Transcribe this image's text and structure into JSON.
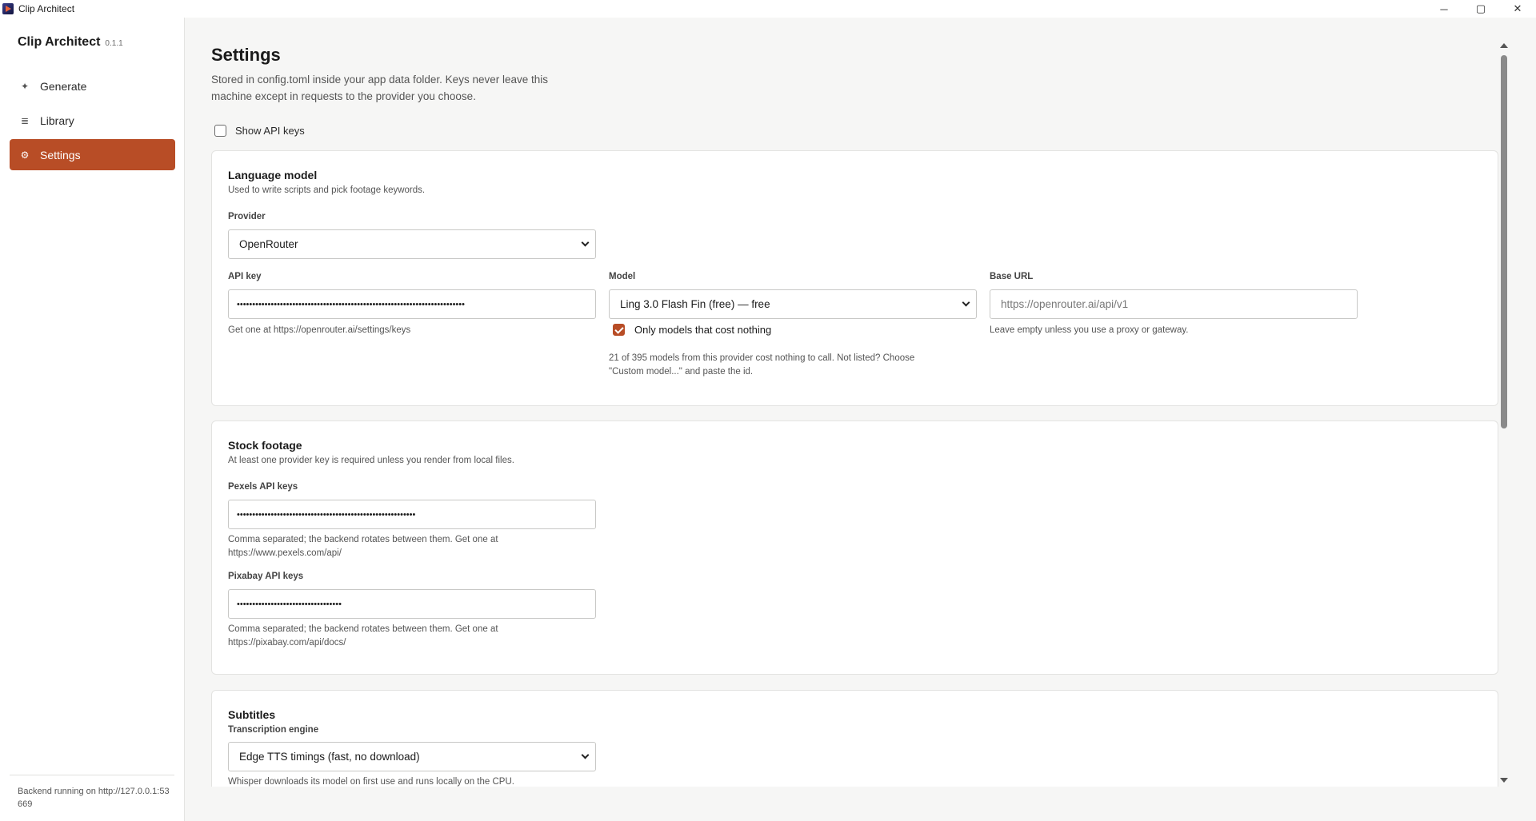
{
  "window": {
    "title": "Clip Architect",
    "controls": {
      "minimize": "─",
      "maximize": "▢",
      "close": "✕"
    }
  },
  "sidebar": {
    "app_name": "Clip Architect",
    "version": "0.1.1",
    "items": [
      {
        "label": "Generate",
        "icon": "sparkle-icon",
        "glyph": "✦",
        "active": false
      },
      {
        "label": "Library",
        "icon": "list-icon",
        "glyph": "≣",
        "active": false
      },
      {
        "label": "Settings",
        "icon": "gear-icon",
        "glyph": "⚙",
        "active": true
      }
    ],
    "backend_status": "Backend running on http://127.0.0.1:53669"
  },
  "settings": {
    "title": "Settings",
    "description": "Stored in config.toml inside your app data folder. Keys never leave this machine except in requests to the provider you choose.",
    "show_keys_label": "Show API keys",
    "show_keys_checked": false
  },
  "language_model": {
    "title": "Language model",
    "description": "Used to write scripts and pick footage keywords.",
    "provider_label": "Provider",
    "provider_value": "OpenRouter",
    "api_key_label": "API key",
    "api_key_value": "••••••••••••••••••••••••••••••••••••••••••••••••••••••••••••••••••••••••••",
    "api_key_hint": "Get one at https://openrouter.ai/settings/keys",
    "model_label": "Model",
    "model_value": "Ling 3.0 Flash Fin (free) — free",
    "free_only_label": "Only models that cost nothing",
    "free_only_checked": true,
    "model_hint": "21 of 395 models from this provider cost nothing to call. Not listed? Choose \"Custom model...\" and paste the id.",
    "base_url_label": "Base URL",
    "base_url_placeholder": "https://openrouter.ai/api/v1",
    "base_url_hint": "Leave empty unless you use a proxy or gateway."
  },
  "stock_footage": {
    "title": "Stock footage",
    "description": "At least one provider key is required unless you render from local files.",
    "pexels_label": "Pexels API keys",
    "pexels_value": "••••••••••••••••••••••••••••••••••••••••••••••••••••••••••",
    "pexels_hint": "Comma separated; the backend rotates between them. Get one at https://www.pexels.com/api/",
    "pixabay_label": "Pixabay API keys",
    "pixabay_value": "••••••••••••••••••••••••••••••••••",
    "pixabay_hint": "Comma separated; the backend rotates between them. Get one at https://pixabay.com/api/docs/"
  },
  "subtitles": {
    "title": "Subtitles",
    "engine_label": "Transcription engine",
    "engine_value": "Edge TTS timings (fast, no download)",
    "engine_hint": "Whisper downloads its model on first use and runs locally on the CPU."
  },
  "colors": {
    "accent": "#b84d26",
    "background": "#f6f6f5",
    "card": "#ffffff"
  }
}
